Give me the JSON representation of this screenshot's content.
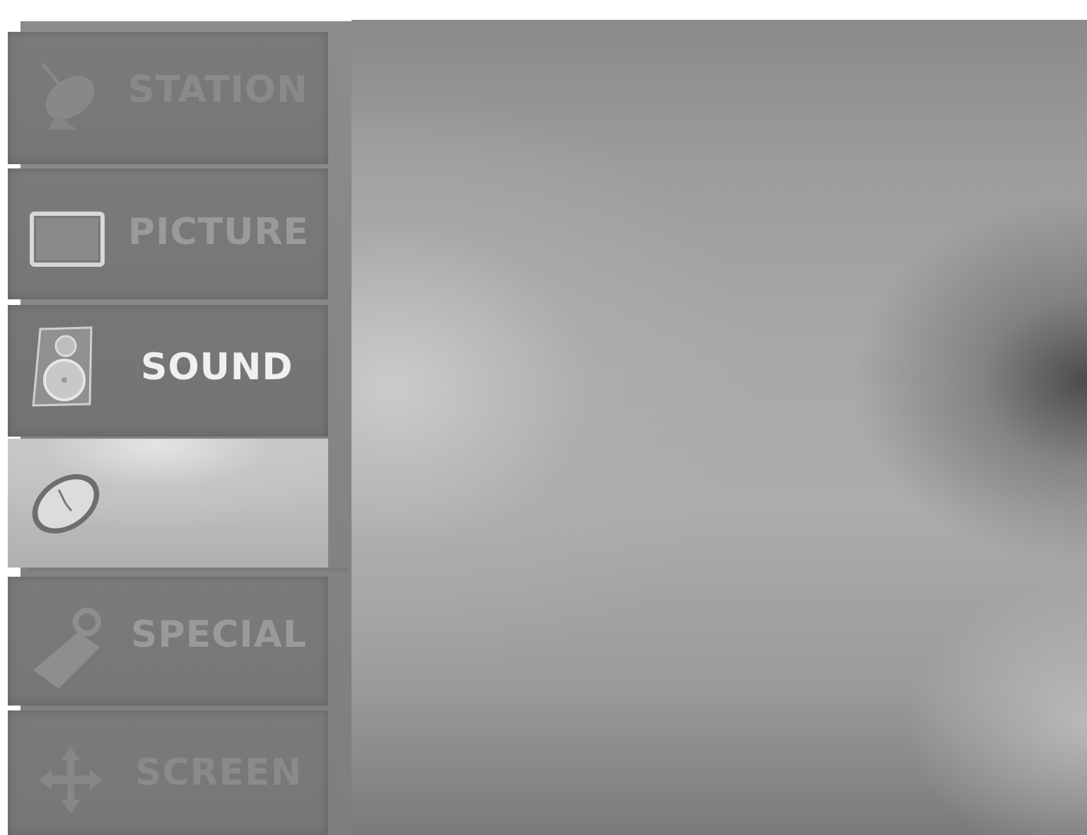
{
  "menu": {
    "items": [
      {
        "label": "STATION",
        "icon": "satellite-dish-icon",
        "state": "dim"
      },
      {
        "label": "PICTURE",
        "icon": "picture-icon",
        "state": "normal"
      },
      {
        "label": "SOUND",
        "icon": "speaker-icon",
        "state": "active"
      },
      {
        "label": "",
        "icon": "clock-icon",
        "state": "highlight"
      },
      {
        "label": "SPECIAL",
        "icon": "tag-icon",
        "state": "normal"
      },
      {
        "label": "SCREEN",
        "icon": "move-arrows-icon",
        "state": "dim"
      }
    ]
  },
  "colors": {
    "sidebar": "#808080",
    "item": "#7a7a7a",
    "label_inactive": "#9a9a9a",
    "label_active": "#f0f0f0",
    "highlight": "#c4c4c4"
  }
}
